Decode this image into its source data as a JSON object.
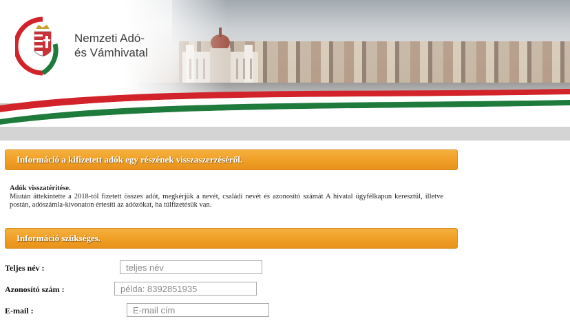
{
  "header": {
    "logo_line1": "Nemzeti Adó-",
    "logo_line2": "és Vámhivatal",
    "colors": {
      "red": "#d2232a",
      "green": "#1e7b3c",
      "orange": "#f0a027"
    }
  },
  "sections": {
    "refund_title": "Információ a kifizetett adók egy részének visszaszerzéséről.",
    "required_title": "Információ szükséges."
  },
  "info": {
    "heading": "Adók visszatérítése.",
    "body": "Miután áttekintette a 2018-tól fizetett összes adót, megkérjük a nevét, családi nevét és azonosító számát A hivatal ügyfélkapun keresztül, illetve postán, adószámla-kivonaton értesíti az adózókat, ha túlfizetésük van."
  },
  "form": {
    "fullname": {
      "label": "Teljes név :",
      "placeholder": "teljes név"
    },
    "idnumber": {
      "label": "Azonosító szám :",
      "placeholder": "példa: 8392851935"
    },
    "email": {
      "label": "E-mail :",
      "placeholder": "E-mail cím"
    }
  }
}
